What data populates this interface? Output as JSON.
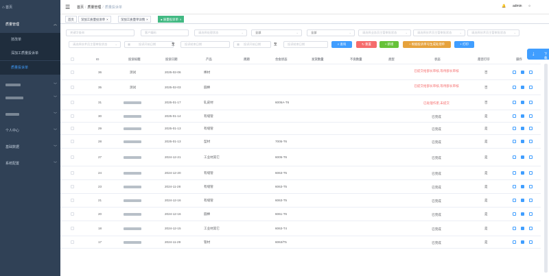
{
  "sidebar": {
    "items": [
      {
        "label": "首页",
        "icon": "home-icon"
      },
      {
        "label": "质量管理",
        "icon": "quality-icon"
      },
      {
        "label": "",
        "icon": "folder-icon"
      },
      {
        "label": "",
        "icon": "folder-icon"
      },
      {
        "label": "",
        "icon": "folder-icon"
      },
      {
        "label": "个人中心",
        "icon": "user-icon"
      },
      {
        "label": "基础数据",
        "icon": "data-icon"
      },
      {
        "label": "系统配置",
        "icon": "system-icon"
      }
    ],
    "sub_items": [
      {
        "label": "技改单"
      },
      {
        "label": "深加工质量投诉单"
      },
      {
        "label": "质量投诉单"
      }
    ]
  },
  "navbar": {
    "breadcrumb": [
      "首页",
      "质量管理",
      "质量投诉单"
    ],
    "user": "admin"
  },
  "tags": [
    {
      "label": "首页"
    },
    {
      "label": "深加工质量投诉单"
    },
    {
      "label": "深加工质量单详情"
    },
    {
      "label": "质量投诉单"
    }
  ],
  "filters": {
    "keyword": "关键字查询",
    "customer": "客户编码",
    "review_status": "请选择处理状态",
    "all_1": "全部",
    "all_2": "全部",
    "hidden_1": "请选择业务员主管审批状态",
    "hidden_2": "请选择技术员主管审批状态",
    "hidden_3": "请选择技术员主管审批状态",
    "tech_manager": "请选择技术员主管审批状态",
    "start_date_1": "投诉开始日期",
    "to_1": "至",
    "end_date_1": "投诉结束日期",
    "start_date_2": "投诉开始日期",
    "to_2": "至",
    "end_date_2": "投诉结束日期"
  },
  "buttons": {
    "search": "查询",
    "reset": "重置",
    "add": "新增",
    "batch": "根据投诉单号生成处理单",
    "print": "打印"
  },
  "float_button": {
    "label": "下载"
  },
  "table": {
    "headers": [
      "ID",
      "投诉标题",
      "投诉日期",
      "产品",
      "周期",
      "合金状态",
      "发货数量",
      "不良数量",
      "类型",
      "状态",
      "是否打印",
      "操作"
    ],
    "rows": [
      {
        "id": "36",
        "title": "测试",
        "date": "2025-02-06",
        "product": "棒材",
        "alloy": "",
        "status": "已提交给部长审核,等待部长审核",
        "status_color": "#f56c6c",
        "printed": "否",
        "blur": false
      },
      {
        "id": "35",
        "title": "测试",
        "date": "2025-02-03",
        "product": "圆棒",
        "alloy": "",
        "status": "已提交给部长审核,等待部长审核",
        "status_color": "#f56c6c",
        "printed": "否",
        "blur": false
      },
      {
        "id": "31",
        "title": "",
        "date": "2025-01-17",
        "product": "轧皮材",
        "alloy": "6005A-T6",
        "status": "已处理作废,未提交",
        "status_color": "#f56c6c",
        "printed": "否",
        "blur": true
      },
      {
        "id": "30",
        "title": "",
        "date": "2025-01-14",
        "product": "有缝管",
        "alloy": "",
        "status": "已完成",
        "status_color": "#606266",
        "printed": "是",
        "blur": true
      },
      {
        "id": "29",
        "title": "",
        "date": "2025-01-13",
        "product": "有缝管",
        "alloy": "",
        "status": "已完成",
        "status_color": "#606266",
        "printed": "是",
        "blur": true
      },
      {
        "id": "28",
        "title": "",
        "date": "2025-01-13",
        "product": "型材",
        "alloy": "7005-T6",
        "status": "已完成",
        "status_color": "#606266",
        "printed": "是",
        "blur": true
      },
      {
        "id": "27",
        "title": "",
        "date": "2024-12-21",
        "product": "工业材其它",
        "alloy": "6005-T6",
        "status": "已完成",
        "status_color": "#606266",
        "printed": "是",
        "blur": true
      },
      {
        "id": "24",
        "title": "",
        "date": "2024-12-20",
        "product": "有缝管",
        "alloy": "6063-T5",
        "status": "已完成",
        "status_color": "#606266",
        "printed": "是",
        "blur": true
      },
      {
        "id": "23",
        "title": "",
        "date": "2024-11-28",
        "product": "有缝管",
        "alloy": "6063-T5",
        "status": "已完成",
        "status_color": "#606266",
        "printed": "是",
        "blur": true
      },
      {
        "id": "21",
        "title": "",
        "date": "2024-12-16",
        "product": "有缝管",
        "alloy": "6063-T5",
        "status": "已完成",
        "status_color": "#606266",
        "printed": "是",
        "blur": true
      },
      {
        "id": "20",
        "title": "",
        "date": "2024-12-16",
        "product": "圆棒",
        "alloy": "6061-T6",
        "status": "已完成",
        "status_color": "#606266",
        "printed": "是",
        "blur": true
      },
      {
        "id": "18",
        "title": "",
        "date": "2024-12-15",
        "product": "工业材其它",
        "alloy": "6063-T4",
        "status": "已完成",
        "status_color": "#606266",
        "printed": "是",
        "blur": true
      },
      {
        "id": "17",
        "title": "",
        "date": "2024-11-29",
        "product": "管材",
        "alloy": "6063/T5",
        "status": "已完成",
        "status_color": "#606266",
        "printed": "是",
        "blur": true
      }
    ]
  }
}
